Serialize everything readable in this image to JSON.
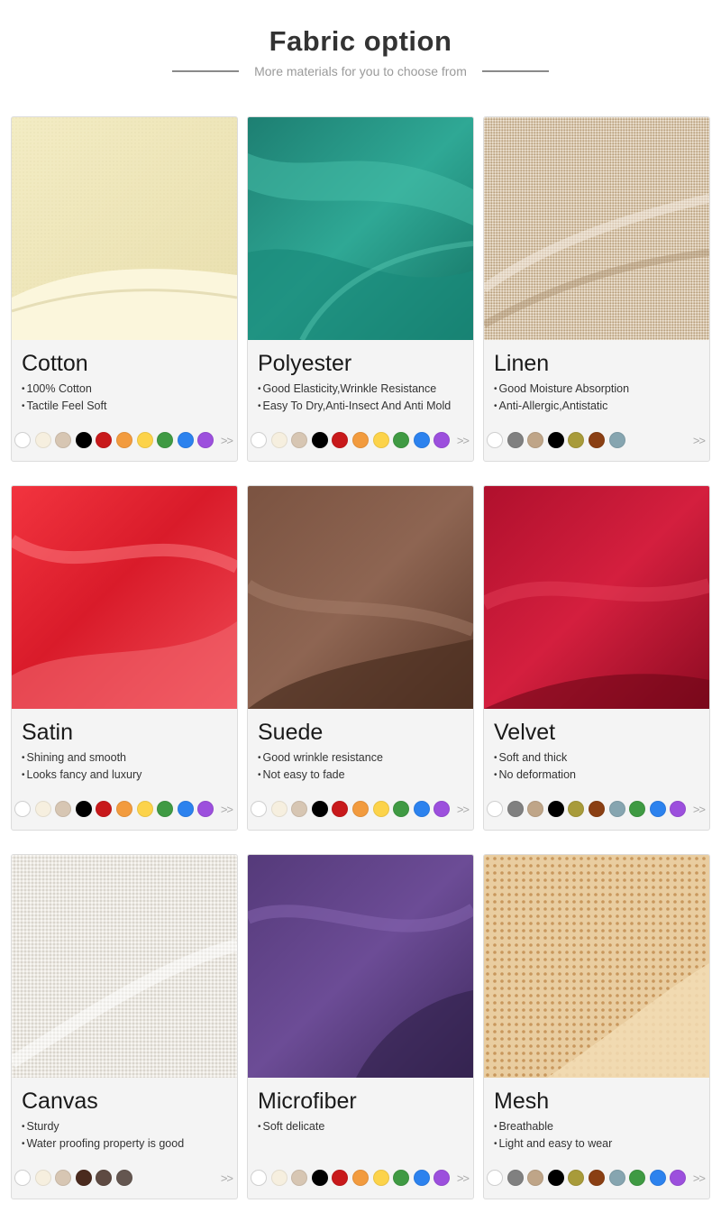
{
  "header": {
    "title": "Fabric option",
    "subtitle": "More materials for you to choose from"
  },
  "more_label": ">>",
  "fabrics": [
    {
      "name": "Cotton",
      "features": [
        "100% Cotton",
        "Tactile Feel Soft"
      ],
      "image": "cotton",
      "swatches": [
        "#ffffff",
        "#f6efdf",
        "#d7c6b3",
        "#000000",
        "#c8191b",
        "#f29b3e",
        "#fcd34a",
        "#3f9a43",
        "#2c82ee",
        "#9c4fdd"
      ]
    },
    {
      "name": "Polyester",
      "features": [
        "Good Elasticity,Wrinkle Resistance",
        "Easy To Dry,Anti-Insect And Anti Mold"
      ],
      "image": "polyester",
      "swatches": [
        "#ffffff",
        "#f6efdf",
        "#d7c6b3",
        "#000000",
        "#c8191b",
        "#f29b3e",
        "#fcd34a",
        "#3f9a43",
        "#2c82ee",
        "#9c4fdd"
      ]
    },
    {
      "name": "Linen",
      "features": [
        "Good Moisture Absorption",
        "Anti-Allergic,Antistatic"
      ],
      "image": "linen",
      "swatches": [
        "#ffffff",
        "#808080",
        "#bfa588",
        "#000000",
        "#a89b3a",
        "#8a3f13",
        "#86a5b0"
      ]
    },
    {
      "name": "Satin",
      "features": [
        "Shining and smooth",
        "Looks fancy and luxury"
      ],
      "image": "satin",
      "swatches": [
        "#ffffff",
        "#f6efdf",
        "#d7c6b3",
        "#000000",
        "#c8191b",
        "#f29b3e",
        "#fcd34a",
        "#3f9a43",
        "#2c82ee",
        "#9c4fdd"
      ]
    },
    {
      "name": "Suede",
      "features": [
        "Good wrinkle resistance",
        "Not easy to fade"
      ],
      "image": "suede",
      "swatches": [
        "#ffffff",
        "#f6efdf",
        "#d7c6b3",
        "#000000",
        "#c8191b",
        "#f29b3e",
        "#fcd34a",
        "#3f9a43",
        "#2c82ee",
        "#9c4fdd"
      ]
    },
    {
      "name": "Velvet",
      "features": [
        "Soft and thick",
        "No deformation"
      ],
      "image": "velvet",
      "swatches": [
        "#ffffff",
        "#808080",
        "#bfa588",
        "#000000",
        "#a89b3a",
        "#8a3f13",
        "#86a5b0",
        "#3f9a43",
        "#2c82ee",
        "#9c4fdd"
      ]
    },
    {
      "name": "Canvas",
      "features": [
        "Sturdy",
        "Water proofing property is good"
      ],
      "image": "canvas",
      "swatches": [
        "#ffffff",
        "#f6efdf",
        "#d7c6b3",
        "#4a2a1e",
        "#5e4a42",
        "#645650"
      ]
    },
    {
      "name": "Microfiber",
      "features": [
        "Soft delicate"
      ],
      "image": "microfiber",
      "swatches": [
        "#ffffff",
        "#f6efdf",
        "#d7c6b3",
        "#000000",
        "#c8191b",
        "#f29b3e",
        "#fcd34a",
        "#3f9a43",
        "#2c82ee",
        "#9c4fdd"
      ]
    },
    {
      "name": "Mesh",
      "features": [
        "Breathable",
        "Light and easy to wear"
      ],
      "image": "mesh",
      "swatches": [
        "#ffffff",
        "#808080",
        "#bfa588",
        "#000000",
        "#a89b3a",
        "#8a3f13",
        "#86a5b0",
        "#3f9a43",
        "#2c82ee",
        "#9c4fdd"
      ]
    }
  ]
}
